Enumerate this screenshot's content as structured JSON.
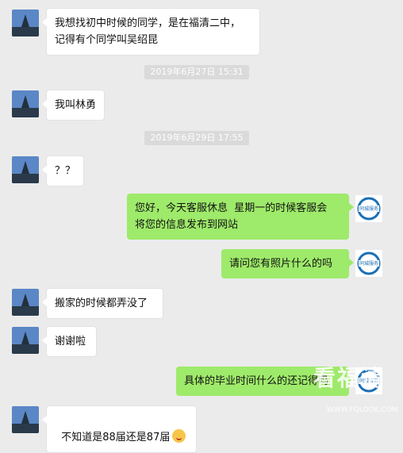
{
  "messages": [
    {
      "side": "left",
      "text": "我想找初中时候的同学，是在福清二中，\n记得有个同学叫吴绍昆"
    },
    {
      "side": "left",
      "text": "我叫林勇"
    },
    {
      "side": "left",
      "text": "？？"
    },
    {
      "side": "right",
      "text": "您好，今天客服休息  星期一的时候客服会\n将您的信息发布到网站"
    },
    {
      "side": "right",
      "text": "请问您有照片什么的吗"
    },
    {
      "side": "left",
      "text": "搬家的时候都弄没了"
    },
    {
      "side": "left",
      "text": "谢谢啦"
    },
    {
      "side": "right",
      "text": "具体的毕业时间什么的还记得吗"
    },
    {
      "side": "left",
      "text": "不知道是88届还是87届"
    }
  ],
  "timestamps": [
    "2019年6月27日 15:31",
    "2019年6月29日 17:55"
  ],
  "watermark": {
    "title": "看福清",
    "url": "WWW.FQLOOK.COM"
  },
  "service_avatar_text": "同城服务",
  "colors": {
    "bg": "#ebebeb",
    "self_bubble": "#9eea6a",
    "other_bubble": "#ffffff"
  }
}
